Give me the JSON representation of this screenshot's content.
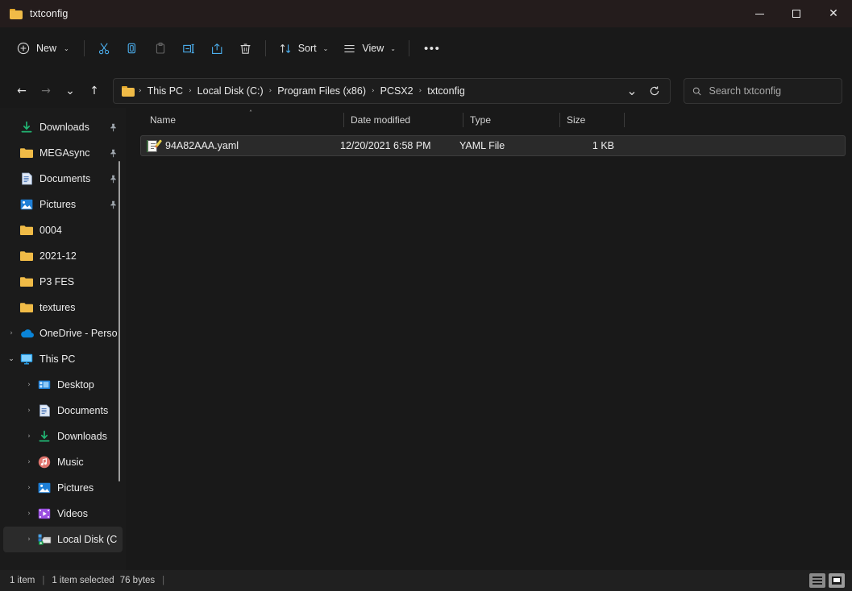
{
  "window": {
    "title": "txtconfig",
    "title_icon": "folder-icon",
    "controls": {
      "minimize": "—",
      "maximize": "□",
      "close": "✕"
    }
  },
  "toolbar": {
    "new_label": "New",
    "new_icon": "plus-circle-icon",
    "cut_icon": "scissors-icon",
    "copy_icon": "copy-icon",
    "paste_icon": "paste-icon",
    "rename_icon": "rename-icon",
    "share_icon": "share-icon",
    "delete_icon": "trash-icon",
    "sort_label": "Sort",
    "sort_icon": "sort-arrows-icon",
    "view_label": "View",
    "view_icon": "list-lines-icon",
    "more_label": "•••",
    "chevron": "⌄"
  },
  "nav": {
    "back_icon": "arrow-left-icon",
    "forward_icon": "arrow-right-icon",
    "recent_icon": "chevron-down-icon",
    "up_icon": "arrow-up-icon",
    "back_glyph": "←",
    "forward_glyph": "→",
    "recent_glyph": "⌄",
    "up_glyph": "↑",
    "dropdown_glyph": "⌄",
    "refresh_glyph": "⟳"
  },
  "breadcrumb": {
    "icon": "folder-icon",
    "separator": "›",
    "items": [
      {
        "label": "This PC"
      },
      {
        "label": "Local Disk (C:)"
      },
      {
        "label": "Program Files (x86)"
      },
      {
        "label": "PCSX2"
      },
      {
        "label": "txtconfig"
      }
    ]
  },
  "search": {
    "icon": "search-icon",
    "placeholder": "Search txtconfig",
    "value": ""
  },
  "sidebar": {
    "items": [
      {
        "label": "Downloads",
        "icon": "download-icon",
        "pinned": true,
        "expander": "",
        "indent": 0
      },
      {
        "label": "MEGAsync",
        "icon": "folder-icon",
        "pinned": true,
        "expander": "",
        "indent": 0
      },
      {
        "label": "Documents",
        "icon": "document-icon",
        "pinned": true,
        "expander": "",
        "indent": 0
      },
      {
        "label": "Pictures",
        "icon": "pictures-icon",
        "pinned": true,
        "expander": "",
        "indent": 0
      },
      {
        "label": "0004",
        "icon": "folder-icon",
        "pinned": false,
        "expander": "",
        "indent": 0
      },
      {
        "label": "2021-12",
        "icon": "folder-icon",
        "pinned": false,
        "expander": "",
        "indent": 0
      },
      {
        "label": "P3 FES",
        "icon": "folder-icon",
        "pinned": false,
        "expander": "",
        "indent": 0
      },
      {
        "label": "textures",
        "icon": "folder-icon",
        "pinned": false,
        "expander": "",
        "indent": 0
      },
      {
        "label": "OneDrive - Perso",
        "icon": "onedrive-icon",
        "pinned": false,
        "expander": "›",
        "indent": 0
      },
      {
        "label": "This PC",
        "icon": "monitor-icon",
        "pinned": false,
        "expander": "⌄",
        "indent": 0,
        "expanded": true
      },
      {
        "label": "Desktop",
        "icon": "desktop-icon",
        "pinned": false,
        "expander": "›",
        "indent": 1
      },
      {
        "label": "Documents",
        "icon": "document-icon",
        "pinned": false,
        "expander": "›",
        "indent": 1
      },
      {
        "label": "Downloads",
        "icon": "download-icon",
        "pinned": false,
        "expander": "›",
        "indent": 1
      },
      {
        "label": "Music",
        "icon": "music-icon",
        "pinned": false,
        "expander": "›",
        "indent": 1
      },
      {
        "label": "Pictures",
        "icon": "pictures-icon",
        "pinned": false,
        "expander": "›",
        "indent": 1
      },
      {
        "label": "Videos",
        "icon": "video-icon",
        "pinned": false,
        "expander": "›",
        "indent": 1
      },
      {
        "label": "Local Disk (C:)",
        "icon": "drive-icon",
        "pinned": false,
        "expander": "›",
        "indent": 1,
        "selected": true
      }
    ],
    "pin_glyph": "📌"
  },
  "filelist": {
    "columns": [
      {
        "key": "name",
        "label": "Name",
        "sorted": "asc",
        "sort_glyph": "˄"
      },
      {
        "key": "date",
        "label": "Date modified"
      },
      {
        "key": "type",
        "label": "Type"
      },
      {
        "key": "size",
        "label": "Size"
      }
    ],
    "rows": [
      {
        "icon": "yaml-file-icon",
        "name": "94A82AAA.yaml",
        "date": "12/20/2021 6:58 PM",
        "type": "YAML File",
        "size": "1 KB",
        "selected": true
      }
    ]
  },
  "statusbar": {
    "item_count": "1 item",
    "divider": "|",
    "selection": "1 item selected",
    "selection_size": "76 bytes",
    "trailing_divider": "|",
    "view_details_icon": "details-view-icon",
    "view_tiles_icon": "large-icons-view-icon"
  },
  "colors": {
    "window_bg": "#191919",
    "sidebar_bg": "#1b1b1b",
    "titlebar_bg": "#241c1c",
    "accent": "#4cb0f0",
    "folder_yellow": "#f0bb47",
    "selected_row": "#2a2a2a"
  }
}
